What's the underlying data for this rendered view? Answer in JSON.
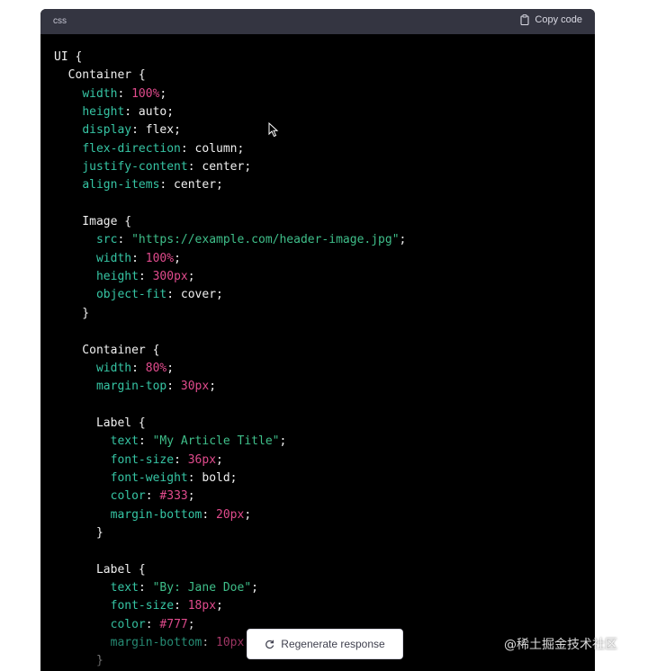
{
  "code_block": {
    "language": "css",
    "copy_label": "Copy code",
    "lines": [
      [
        {
          "t": "UI {",
          "c": "plain"
        }
      ],
      [
        {
          "t": "  Container {",
          "c": "plain"
        }
      ],
      [
        {
          "t": "    ",
          "c": "plain"
        },
        {
          "t": "width",
          "c": "prop"
        },
        {
          "t": ": ",
          "c": "plain"
        },
        {
          "t": "100%",
          "c": "num"
        },
        {
          "t": ";",
          "c": "plain"
        }
      ],
      [
        {
          "t": "    ",
          "c": "plain"
        },
        {
          "t": "height",
          "c": "prop"
        },
        {
          "t": ": auto;",
          "c": "plain"
        }
      ],
      [
        {
          "t": "    ",
          "c": "plain"
        },
        {
          "t": "display",
          "c": "prop"
        },
        {
          "t": ": flex;",
          "c": "plain"
        }
      ],
      [
        {
          "t": "    ",
          "c": "plain"
        },
        {
          "t": "flex-direction",
          "c": "prop"
        },
        {
          "t": ": column;",
          "c": "plain"
        }
      ],
      [
        {
          "t": "    ",
          "c": "plain"
        },
        {
          "t": "justify-content",
          "c": "prop"
        },
        {
          "t": ": center;",
          "c": "plain"
        }
      ],
      [
        {
          "t": "    ",
          "c": "plain"
        },
        {
          "t": "align-items",
          "c": "prop"
        },
        {
          "t": ": center;",
          "c": "plain"
        }
      ],
      [
        {
          "t": "",
          "c": "plain"
        }
      ],
      [
        {
          "t": "    Image {",
          "c": "plain"
        }
      ],
      [
        {
          "t": "      ",
          "c": "plain"
        },
        {
          "t": "src",
          "c": "prop"
        },
        {
          "t": ": ",
          "c": "plain"
        },
        {
          "t": "\"https://example.com/header-image.jpg\"",
          "c": "str"
        },
        {
          "t": ";",
          "c": "plain"
        }
      ],
      [
        {
          "t": "      ",
          "c": "plain"
        },
        {
          "t": "width",
          "c": "prop"
        },
        {
          "t": ": ",
          "c": "plain"
        },
        {
          "t": "100%",
          "c": "num"
        },
        {
          "t": ";",
          "c": "plain"
        }
      ],
      [
        {
          "t": "      ",
          "c": "plain"
        },
        {
          "t": "height",
          "c": "prop"
        },
        {
          "t": ": ",
          "c": "plain"
        },
        {
          "t": "300px",
          "c": "num"
        },
        {
          "t": ";",
          "c": "plain"
        }
      ],
      [
        {
          "t": "      ",
          "c": "plain"
        },
        {
          "t": "object-fit",
          "c": "prop"
        },
        {
          "t": ": cover;",
          "c": "plain"
        }
      ],
      [
        {
          "t": "    }",
          "c": "plain"
        }
      ],
      [
        {
          "t": "",
          "c": "plain"
        }
      ],
      [
        {
          "t": "    Container {",
          "c": "plain"
        }
      ],
      [
        {
          "t": "      ",
          "c": "plain"
        },
        {
          "t": "width",
          "c": "prop"
        },
        {
          "t": ": ",
          "c": "plain"
        },
        {
          "t": "80%",
          "c": "num"
        },
        {
          "t": ";",
          "c": "plain"
        }
      ],
      [
        {
          "t": "      ",
          "c": "plain"
        },
        {
          "t": "margin-top",
          "c": "prop"
        },
        {
          "t": ": ",
          "c": "plain"
        },
        {
          "t": "30px",
          "c": "num"
        },
        {
          "t": ";",
          "c": "plain"
        }
      ],
      [
        {
          "t": "",
          "c": "plain"
        }
      ],
      [
        {
          "t": "      Label {",
          "c": "plain"
        }
      ],
      [
        {
          "t": "        ",
          "c": "plain"
        },
        {
          "t": "text",
          "c": "prop"
        },
        {
          "t": ": ",
          "c": "plain"
        },
        {
          "t": "\"My Article Title\"",
          "c": "str"
        },
        {
          "t": ";",
          "c": "plain"
        }
      ],
      [
        {
          "t": "        ",
          "c": "plain"
        },
        {
          "t": "font-size",
          "c": "prop"
        },
        {
          "t": ": ",
          "c": "plain"
        },
        {
          "t": "36px",
          "c": "num"
        },
        {
          "t": ";",
          "c": "plain"
        }
      ],
      [
        {
          "t": "        ",
          "c": "plain"
        },
        {
          "t": "font-weight",
          "c": "prop"
        },
        {
          "t": ": bold;",
          "c": "plain"
        }
      ],
      [
        {
          "t": "        ",
          "c": "plain"
        },
        {
          "t": "color",
          "c": "prop"
        },
        {
          "t": ": ",
          "c": "plain"
        },
        {
          "t": "#333",
          "c": "num"
        },
        {
          "t": ";",
          "c": "plain"
        }
      ],
      [
        {
          "t": "        ",
          "c": "plain"
        },
        {
          "t": "margin-bottom",
          "c": "prop"
        },
        {
          "t": ": ",
          "c": "plain"
        },
        {
          "t": "20px",
          "c": "num"
        },
        {
          "t": ";",
          "c": "plain"
        }
      ],
      [
        {
          "t": "      }",
          "c": "plain"
        }
      ],
      [
        {
          "t": "",
          "c": "plain"
        }
      ],
      [
        {
          "t": "      Label {",
          "c": "plain"
        }
      ],
      [
        {
          "t": "        ",
          "c": "plain"
        },
        {
          "t": "text",
          "c": "prop"
        },
        {
          "t": ": ",
          "c": "plain"
        },
        {
          "t": "\"By: Jane Doe\"",
          "c": "str"
        },
        {
          "t": ";",
          "c": "plain"
        }
      ],
      [
        {
          "t": "        ",
          "c": "plain"
        },
        {
          "t": "font-size",
          "c": "prop"
        },
        {
          "t": ": ",
          "c": "plain"
        },
        {
          "t": "18px",
          "c": "num"
        },
        {
          "t": ";",
          "c": "plain"
        }
      ],
      [
        {
          "t": "        ",
          "c": "plain"
        },
        {
          "t": "color",
          "c": "prop"
        },
        {
          "t": ": ",
          "c": "plain"
        },
        {
          "t": "#777",
          "c": "num"
        },
        {
          "t": ";",
          "c": "plain"
        }
      ],
      [
        {
          "t": "        ",
          "c": "plain"
        },
        {
          "t": "margin-bottom",
          "c": "prop"
        },
        {
          "t": ": ",
          "c": "plain"
        },
        {
          "t": "10px",
          "c": "num"
        },
        {
          "t": ";",
          "c": "plain"
        }
      ],
      [
        {
          "t": "      }",
          "c": "plain"
        }
      ]
    ]
  },
  "regenerate_label": "Regenerate response",
  "watermark": "@稀土掘金技术社区",
  "colors": {
    "code_bg": "#000000",
    "header_bg": "#343541",
    "property": "#36c5a4",
    "number": "#e14b8d",
    "string": "#3fbf8a"
  },
  "icons": {
    "copy": "clipboard-icon",
    "regenerate": "refresh-icon",
    "cursor": "mouse-pointer-icon"
  }
}
